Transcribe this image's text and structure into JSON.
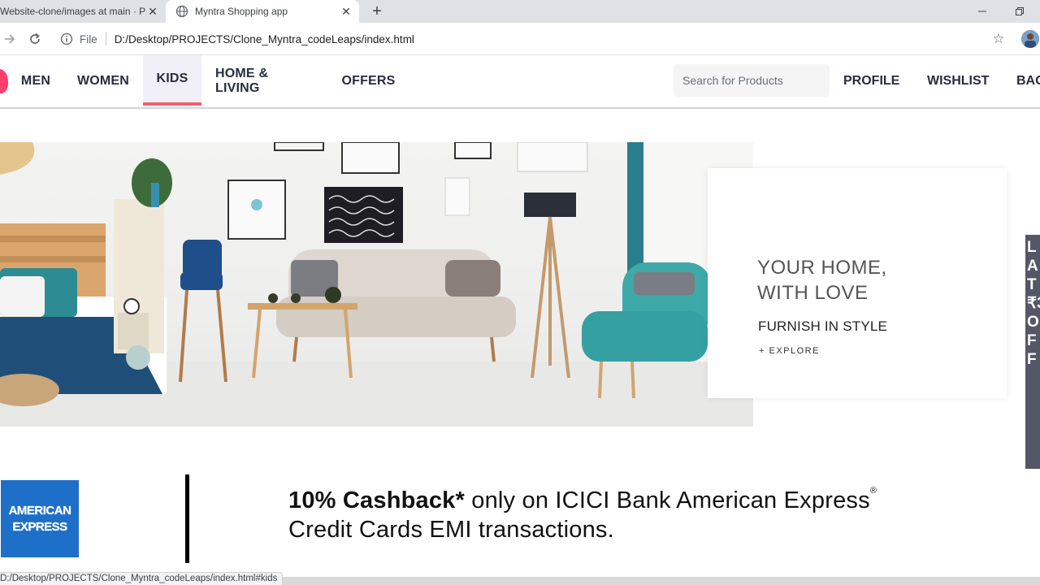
{
  "browser": {
    "tabs": [
      {
        "title": "Website-clone/images at main · P",
        "active": false
      },
      {
        "title": "Myntra Shopping app",
        "active": true
      }
    ],
    "address": {
      "scheme": "File",
      "path": "D:/Desktop/PROJECTS/Clone_Myntra_codeLeaps/index.html"
    },
    "status_url": "D:/Desktop/PROJECTS/Clone_Myntra_codeLeaps/index.html#kids"
  },
  "header": {
    "nav": [
      "MEN",
      "WOMEN",
      "KIDS",
      "HOME & LIVING",
      "OFFERS"
    ],
    "active_nav": "KIDS",
    "search_placeholder": "Search for Products",
    "links": [
      "PROFILE",
      "WISHLIST",
      "BAG"
    ]
  },
  "banner": {
    "headline_line1": "YOUR HOME,",
    "headline_line2": "WITH LOVE",
    "subhead": "FURNISH IN STYLE",
    "cta": "+ EXPLORE"
  },
  "side_strip": {
    "chars": [
      "L",
      "A",
      "T",
      "₹3",
      "O",
      "F",
      "F"
    ]
  },
  "amex": {
    "logo_line1": "AMERICAN",
    "logo_line2": "EXPRESS",
    "offer_bold": "10% Cashback*",
    "offer_rest": " only on ICICI Bank American Express",
    "reg_mark": "®",
    "offer_line2": "Credit Cards EMI transactions."
  },
  "colors": {
    "brand_pink": "#ff3f6c",
    "active_underline": "#ee5f73",
    "amex_blue": "#1d6fc7"
  }
}
